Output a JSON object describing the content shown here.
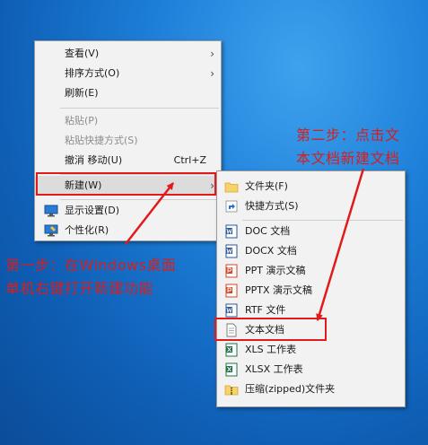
{
  "context_menu": {
    "items": [
      {
        "label": "查看(V)",
        "arrow": "›"
      },
      {
        "label": "排序方式(O)",
        "arrow": "›"
      },
      {
        "label": "刷新(E)"
      },
      {
        "label": "粘贴(P)"
      },
      {
        "label": "粘贴快捷方式(S)"
      },
      {
        "label": "撤消 移动(U)",
        "shortcut": "Ctrl+Z"
      },
      {
        "label": "新建(W)",
        "arrow": "›"
      },
      {
        "label": "显示设置(D)",
        "icon": "display-settings-icon"
      },
      {
        "label": "个性化(R)",
        "icon": "personalize-icon"
      }
    ]
  },
  "new_submenu": {
    "items": [
      {
        "label": "文件夹(F)",
        "icon": "folder-icon"
      },
      {
        "label": "快捷方式(S)",
        "icon": "shortcut-icon"
      },
      {
        "label": "DOC 文档",
        "icon": "word-doc-icon"
      },
      {
        "label": "DOCX 文档",
        "icon": "word-docx-icon"
      },
      {
        "label": "PPT 演示文稿",
        "icon": "ppt-icon"
      },
      {
        "label": "PPTX 演示文稿",
        "icon": "pptx-icon"
      },
      {
        "label": "RTF 文件",
        "icon": "rtf-icon"
      },
      {
        "label": "文本文档",
        "icon": "text-document-icon"
      },
      {
        "label": "XLS 工作表",
        "icon": "xls-icon"
      },
      {
        "label": "XLSX 工作表",
        "icon": "xlsx-icon"
      },
      {
        "label": "压缩(zipped)文件夹",
        "icon": "zip-folder-icon"
      }
    ]
  },
  "annotations": {
    "step1_line1": "第一步：在Windows桌面",
    "step1_line2": "单机右键打开新建功能",
    "step2_line1": "第二步：点击文",
    "step2_line2": "本文档新建文档"
  },
  "colors": {
    "annotation_red": "#e11b1b",
    "desktop_blue": "#1d7fd8"
  }
}
